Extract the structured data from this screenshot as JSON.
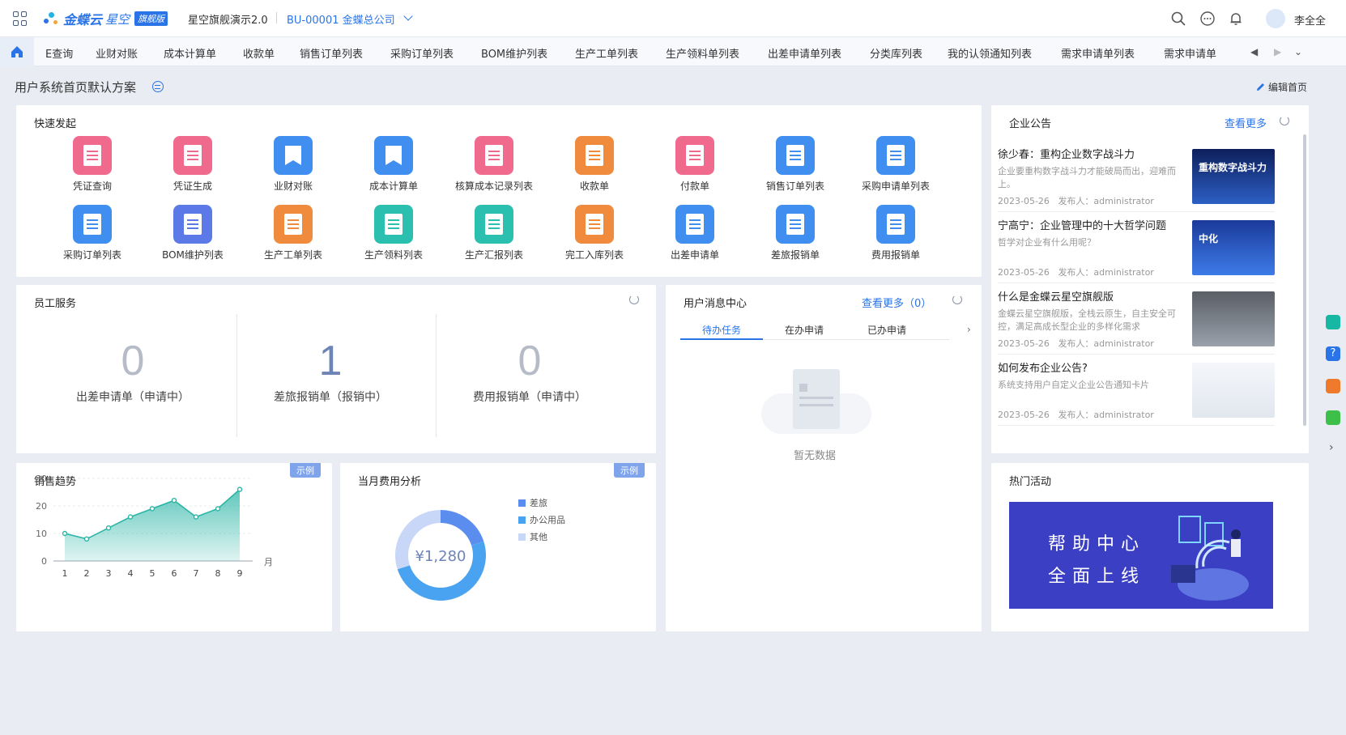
{
  "topbar": {
    "brand": "金蝶云",
    "brand_sub": "星空",
    "edition": "旗舰版",
    "app_title": "星空旗舰演示2.0",
    "org": "BU-00001 金蝶总公司",
    "user": "李全全"
  },
  "tabs": [
    "E查询",
    "业财对账",
    "成本计算单",
    "收款单",
    "销售订单列表",
    "采购订单列表",
    "BOM维护列表",
    "生产工单列表",
    "生产领料单列表",
    "出差申请单列表",
    "分类库列表",
    "我的认领通知列表",
    "需求申请单列表",
    "需求申请单"
  ],
  "header": {
    "title": "用户系统首页默认方案",
    "edit_label": "编辑首页"
  },
  "quick_launch": {
    "title": "快速发起",
    "items": [
      {
        "label": "凭证查询",
        "color": "#ef6a8d",
        "icon": "voucher-icon"
      },
      {
        "label": "凭证生成",
        "color": "#ef6a8d",
        "icon": "voucher-generate-icon"
      },
      {
        "label": "业财对账",
        "color": "#3f8ef0",
        "icon": "bookmark-icon"
      },
      {
        "label": "成本计算单",
        "color": "#3f8ef0",
        "icon": "bookmark-icon"
      },
      {
        "label": "核算成本记录列表",
        "color": "#ef6a8d",
        "icon": "list-icon"
      },
      {
        "label": "收款单",
        "color": "#f08a3c",
        "icon": "receipt-icon"
      },
      {
        "label": "付款单",
        "color": "#ef6a8d",
        "icon": "cart-icon"
      },
      {
        "label": "销售订单列表",
        "color": "#3f8ef0",
        "icon": "document-icon"
      },
      {
        "label": "采购申请单列表",
        "color": "#3f8ef0",
        "icon": "document-icon"
      },
      {
        "label": "采购订单列表",
        "color": "#3f8ef0",
        "icon": "document-icon"
      },
      {
        "label": "BOM维护列表",
        "color": "#5b7ae8",
        "icon": "bom-icon"
      },
      {
        "label": "生产工单列表",
        "color": "#f08a3c",
        "icon": "work-order-icon"
      },
      {
        "label": "生产领料列表",
        "color": "#2bbfb0",
        "icon": "checklist-icon"
      },
      {
        "label": "生产汇报列表",
        "color": "#2bbfb0",
        "icon": "monitor-icon"
      },
      {
        "label": "完工入库列表",
        "color": "#f08a3c",
        "icon": "star-icon"
      },
      {
        "label": "出差申请单",
        "color": "#3f8ef0",
        "icon": "document-icon"
      },
      {
        "label": "差旅报销单",
        "color": "#3f8ef0",
        "icon": "document-icon"
      },
      {
        "label": "费用报销单",
        "color": "#3f8ef0",
        "icon": "document-icon"
      }
    ]
  },
  "employee_service": {
    "title": "员工服务",
    "stats": [
      {
        "value": "0",
        "label": "出差申请单（申请中）"
      },
      {
        "value": "1",
        "label": "差旅报销单（报销中）"
      },
      {
        "value": "0",
        "label": "费用报销单（申请中）"
      }
    ]
  },
  "message_center": {
    "title": "用户消息中心",
    "more": "查看更多（0）",
    "tabs": [
      "待办任务",
      "在办申请",
      "已办申请"
    ],
    "empty": "暂无数据"
  },
  "announcements": {
    "title": "企业公告",
    "more": "查看更多",
    "items": [
      {
        "title": "徐少春：重构企业数字战斗力",
        "desc": "企业要重构数字战斗力才能破局而出，迎难而上。",
        "date": "2023-05-26",
        "publisher": "发布人：administrator",
        "img_text": "重构数字战斗力"
      },
      {
        "title": "宁高宁：企业管理中的十大哲学问题",
        "desc": "哲学对企业有什么用呢？",
        "date": "2023-05-26",
        "publisher": "发布人：administrator",
        "img_text": "中化"
      },
      {
        "title": "什么是金蝶云星空旗舰版",
        "desc": "金蝶云星空旗舰版，全栈云原生，自主安全可控，满足高成长型企业的多样化需求",
        "date": "2023-05-26",
        "publisher": "发布人：administrator",
        "img_text": ""
      },
      {
        "title": "如何发布企业公告?",
        "desc": "系统支持用户自定义企业公告通知卡片",
        "date": "2023-05-26",
        "publisher": "发布人：administrator",
        "img_text": ""
      }
    ]
  },
  "sales_trend": {
    "title": "销售趋势",
    "tag": "示例"
  },
  "expense": {
    "title": "当月费用分析",
    "tag": "示例",
    "center": "¥1,280"
  },
  "hot": {
    "title": "热门活动",
    "line1": "帮助中心",
    "line2": "全面上线"
  },
  "chart_data": [
    {
      "type": "area",
      "title": "销售趋势",
      "x": [
        1,
        2,
        3,
        4,
        5,
        6,
        7,
        8,
        9
      ],
      "values": [
        10,
        8,
        12,
        16,
        19,
        22,
        16,
        19,
        26
      ],
      "xlabel": "月",
      "ylim": [
        0,
        30
      ],
      "yticks": [
        0,
        10,
        20,
        30
      ],
      "color": "#2bb5a6"
    },
    {
      "type": "pie",
      "title": "当月费用分析",
      "labels": [
        "差旅",
        "办公用品",
        "其他"
      ],
      "values": [
        20,
        50,
        30
      ],
      "colors": [
        "#5b8def",
        "#4aa3f0",
        "#c8d7f7"
      ]
    }
  ]
}
